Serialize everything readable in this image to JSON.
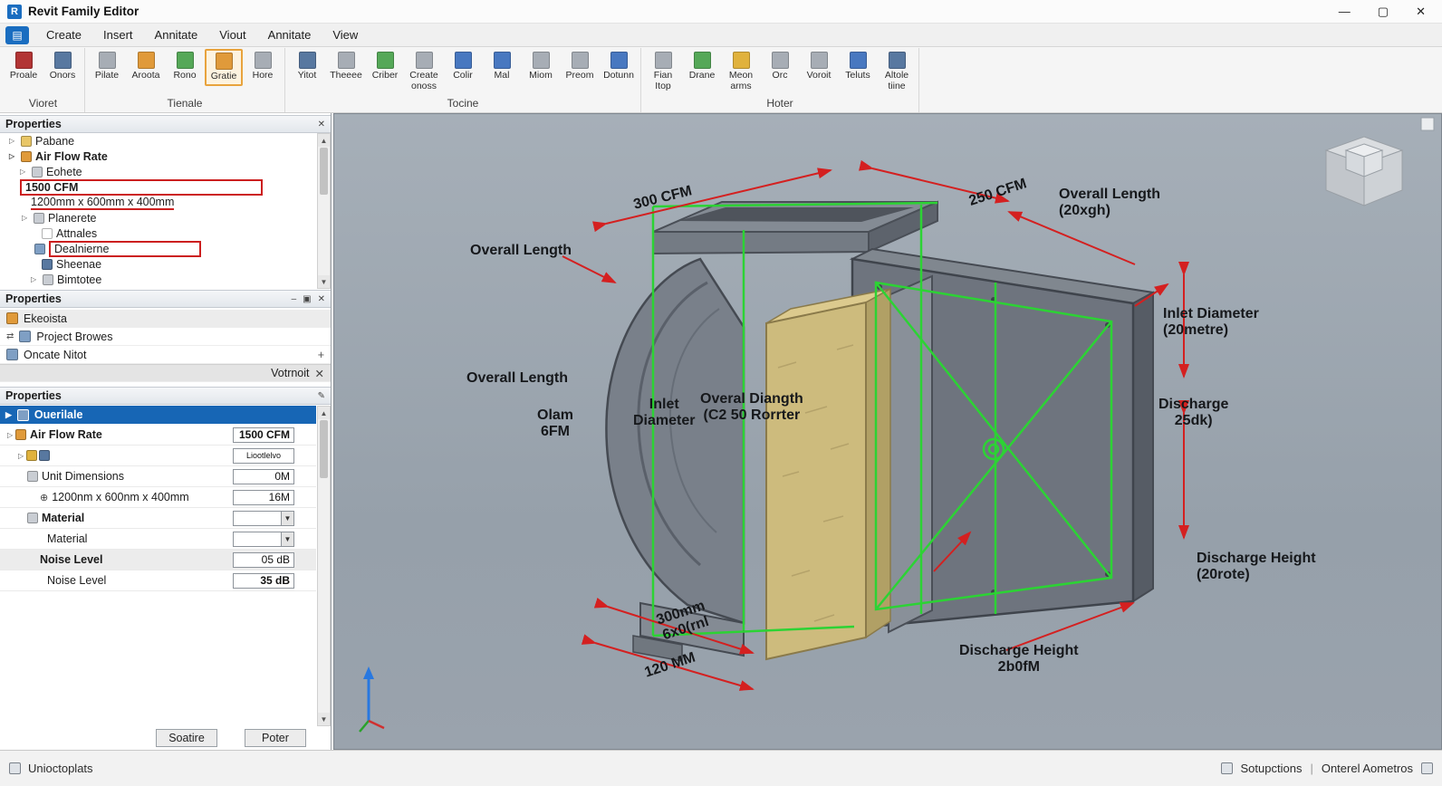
{
  "window": {
    "title": "Revit Family Editor"
  },
  "window_controls": {
    "minimize": "—",
    "maximize": "▢",
    "close": "✕"
  },
  "tabs": [
    {
      "label": "Create"
    },
    {
      "label": "Insert"
    },
    {
      "label": "Annitate"
    },
    {
      "label": "Viout"
    },
    {
      "label": "Annitate"
    },
    {
      "label": "View"
    }
  ],
  "ribbon": {
    "groups": [
      {
        "label": "Vioret",
        "buttons": [
          {
            "label": "Proale",
            "icon": "tool-icon"
          },
          {
            "label": "Onors",
            "icon": "tool-icon"
          }
        ]
      },
      {
        "label": "Tienale",
        "buttons": [
          {
            "label": "Pilate",
            "icon": "tool-icon"
          },
          {
            "label": "Aroota",
            "icon": "tool-icon"
          },
          {
            "label": "Rono",
            "icon": "tool-icon"
          },
          {
            "label": "Gratie",
            "icon": "tool-icon"
          },
          {
            "label": "Hore",
            "icon": "tool-icon"
          }
        ]
      },
      {
        "label": "Tocine",
        "buttons": [
          {
            "label": "Yitot",
            "icon": "tool-icon"
          },
          {
            "label": "Theeee",
            "icon": "tool-icon"
          },
          {
            "label": "Criber",
            "icon": "tool-icon"
          },
          {
            "label": "Create onoss",
            "icon": "tool-icon"
          },
          {
            "label": "Colir",
            "icon": "tool-icon"
          },
          {
            "label": "Mal",
            "icon": "tool-icon"
          },
          {
            "label": "Miom",
            "icon": "tool-icon"
          },
          {
            "label": "Preom",
            "icon": "tool-icon"
          },
          {
            "label": "Dotunn",
            "icon": "tool-icon"
          }
        ]
      },
      {
        "label": "Hoter",
        "buttons": [
          {
            "label": "Fian Itop",
            "icon": "tool-icon"
          },
          {
            "label": "Drane",
            "icon": "tool-icon"
          },
          {
            "label": "Meon arms",
            "icon": "tool-icon"
          },
          {
            "label": "Orc",
            "icon": "tool-icon"
          },
          {
            "label": "Voroit",
            "icon": "tool-icon"
          },
          {
            "label": "Teluts",
            "icon": "tool-icon"
          },
          {
            "label": "Altole tiine",
            "icon": "tool-icon"
          }
        ]
      }
    ]
  },
  "tree_panel": {
    "header": "Properties",
    "items": [
      {
        "label": "Pabane",
        "highlight": "none"
      },
      {
        "label": "Air Flow Rate",
        "highlight": "none"
      },
      {
        "label": "Eohete",
        "highlight": "none"
      },
      {
        "label": "1500 CFM",
        "highlight": "red-box"
      },
      {
        "label": "1200mm x 600mm x 400mm",
        "highlight": "red-underline"
      },
      {
        "label": "Planerete",
        "highlight": "none"
      },
      {
        "label": "Attnales",
        "highlight": "none"
      },
      {
        "label": "Dealnierne",
        "highlight": "red-box"
      },
      {
        "label": "Sheenae",
        "highlight": "none"
      },
      {
        "label": "Bimtotee",
        "highlight": "none"
      }
    ]
  },
  "browser_panel": {
    "header": "Properties",
    "rows": [
      {
        "label": "Ekeoista"
      },
      {
        "label": "Project Browes"
      },
      {
        "label": "Oncate Nitot"
      },
      {
        "label": "Votrnoit"
      }
    ]
  },
  "properties_panel": {
    "header": "Properties",
    "selected_row": "Ouerilale",
    "rows": [
      {
        "label": "Air Flow Rate",
        "value": "1500 CFM"
      },
      {
        "label": "",
        "value": "Liootlelvo"
      },
      {
        "label": "Unit Dimensions",
        "value": "0M"
      },
      {
        "label": "1200nm x 600nm x 400mm",
        "value": "16M"
      },
      {
        "label": "Material",
        "value": ""
      },
      {
        "label": "Material",
        "value": ""
      },
      {
        "label": "Noise Level",
        "value": "05 dB"
      },
      {
        "label": "Noise Level",
        "value": "35 dB"
      }
    ],
    "buttons": [
      {
        "label": "Soatire"
      },
      {
        "label": "Poter"
      }
    ]
  },
  "statusbar": {
    "left": "Unioctoplats",
    "right_primary": "Sotupctions",
    "divider": "|",
    "right_secondary": "Onterel Aometros"
  },
  "viewport": {
    "annotations": [
      {
        "line1": "300 CFM",
        "line2": ""
      },
      {
        "line1": "Overall Length",
        "line2": ""
      },
      {
        "line1": "250 CFM",
        "line2": ""
      },
      {
        "line1": "Overall Length",
        "line2": "(20xgh)"
      },
      {
        "line1": "Inlet Diameter",
        "line2": "(20metre)"
      },
      {
        "line1": "Overall Length",
        "line2": ""
      },
      {
        "line1": "Olam",
        "line2": "6FM"
      },
      {
        "line1": "Inlet",
        "line2": "Diameter"
      },
      {
        "line1": "Overal Diangth",
        "line2": "(C2 50 Rorrter"
      },
      {
        "line1": "Discharge",
        "line2": "25dk)"
      },
      {
        "line1": "Discharge Height",
        "line2": "(20rote)"
      },
      {
        "line1": "300mm",
        "line2": "6x0(rnl"
      },
      {
        "line1": "120 MM",
        "line2": ""
      },
      {
        "line1": "Discharge Height",
        "line2": "2b0fM"
      }
    ]
  },
  "colors": {
    "accent_blue": "#1a6dc0",
    "selection_blue": "#1766b5",
    "annotation_red": "#cc1f1f",
    "dimension_red": "#d42020",
    "wireframe_green": "#2cd334",
    "insulation_tan": "#cdbb7d",
    "viewport_background": "#9aa4ae"
  }
}
